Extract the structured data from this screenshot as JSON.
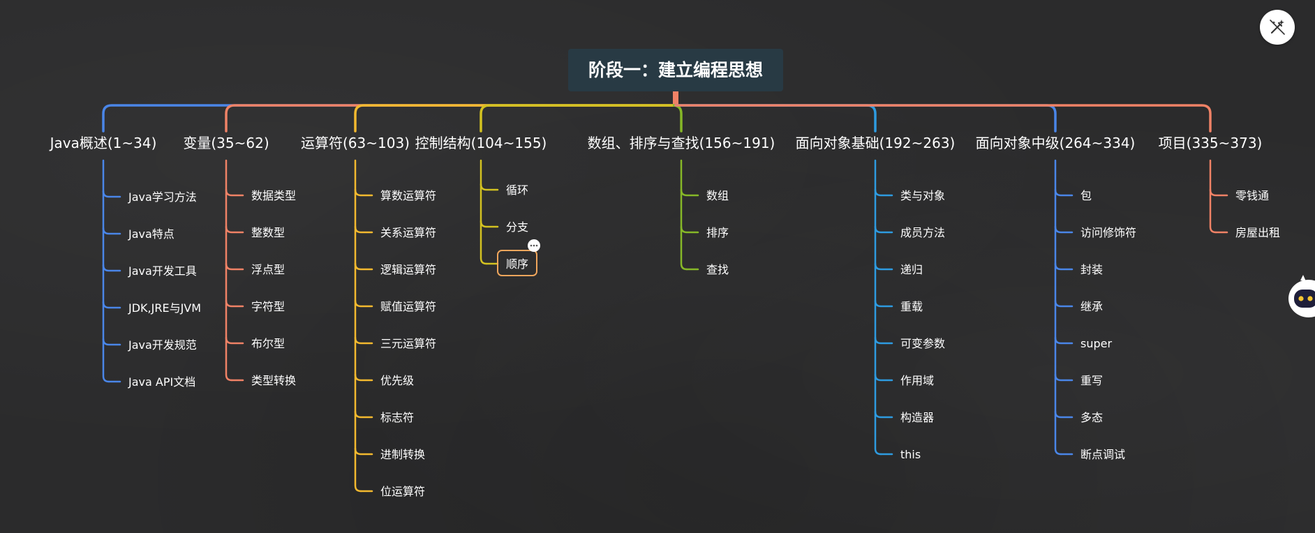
{
  "colors": {
    "background": "#2b2b2c",
    "root_fill": "#283a44",
    "text": "#ffffff",
    "highlight_border": "#f0a65c"
  },
  "toolbar": {
    "magic_icon": "magic-wand-icon"
  },
  "assistant": {
    "icon": "robot-assistant-icon"
  },
  "mindmap": {
    "root": {
      "label": "阶段一：建立编程思想"
    },
    "branches": [
      {
        "id": "java-overview",
        "label": "Java概述(1~34)",
        "color": "#4a86e8",
        "children": [
          "Java学习方法",
          "Java特点",
          "Java开发工具",
          "JDK,JRE与JVM",
          "Java开发规范",
          "Java API文档"
        ]
      },
      {
        "id": "variables",
        "label": "变量(35~62)",
        "color": "#f08266",
        "children": [
          "数据类型",
          "整数型",
          "浮点型",
          "字符型",
          "布尔型",
          "类型转换"
        ]
      },
      {
        "id": "operators",
        "label": "运算符(63~103)",
        "color": "#f3b92f",
        "children": [
          "算数运算符",
          "关系运算符",
          "逻辑运算符",
          "赋值运算符",
          "三元运算符",
          "优先级",
          "标志符",
          "进制转换",
          "位运算符"
        ]
      },
      {
        "id": "control",
        "label": "控制结构(104~155)",
        "color": "#d3c221",
        "children": [
          "循环",
          "分支",
          "顺序"
        ],
        "highlight_index": 2
      },
      {
        "id": "arrays",
        "label": "数组、排序与查找(156~191)",
        "color": "#86b827",
        "children": [
          "数组",
          "排序",
          "查找"
        ]
      },
      {
        "id": "oop-basic",
        "label": "面向对象基础(192~263)",
        "color": "#2e9be0",
        "children": [
          "类与对象",
          "成员方法",
          "递归",
          "重载",
          "可变参数",
          "作用域",
          "构造器",
          "this"
        ]
      },
      {
        "id": "oop-mid",
        "label": "面向对象中级(264~334)",
        "color": "#4a86e8",
        "children": [
          "包",
          "访问修饰符",
          "封装",
          "继承",
          "super",
          "重写",
          "多态",
          "断点调试"
        ]
      },
      {
        "id": "project",
        "label": "项目(335~373)",
        "color": "#f08266",
        "children": [
          "零钱通",
          "房屋出租"
        ]
      }
    ]
  }
}
